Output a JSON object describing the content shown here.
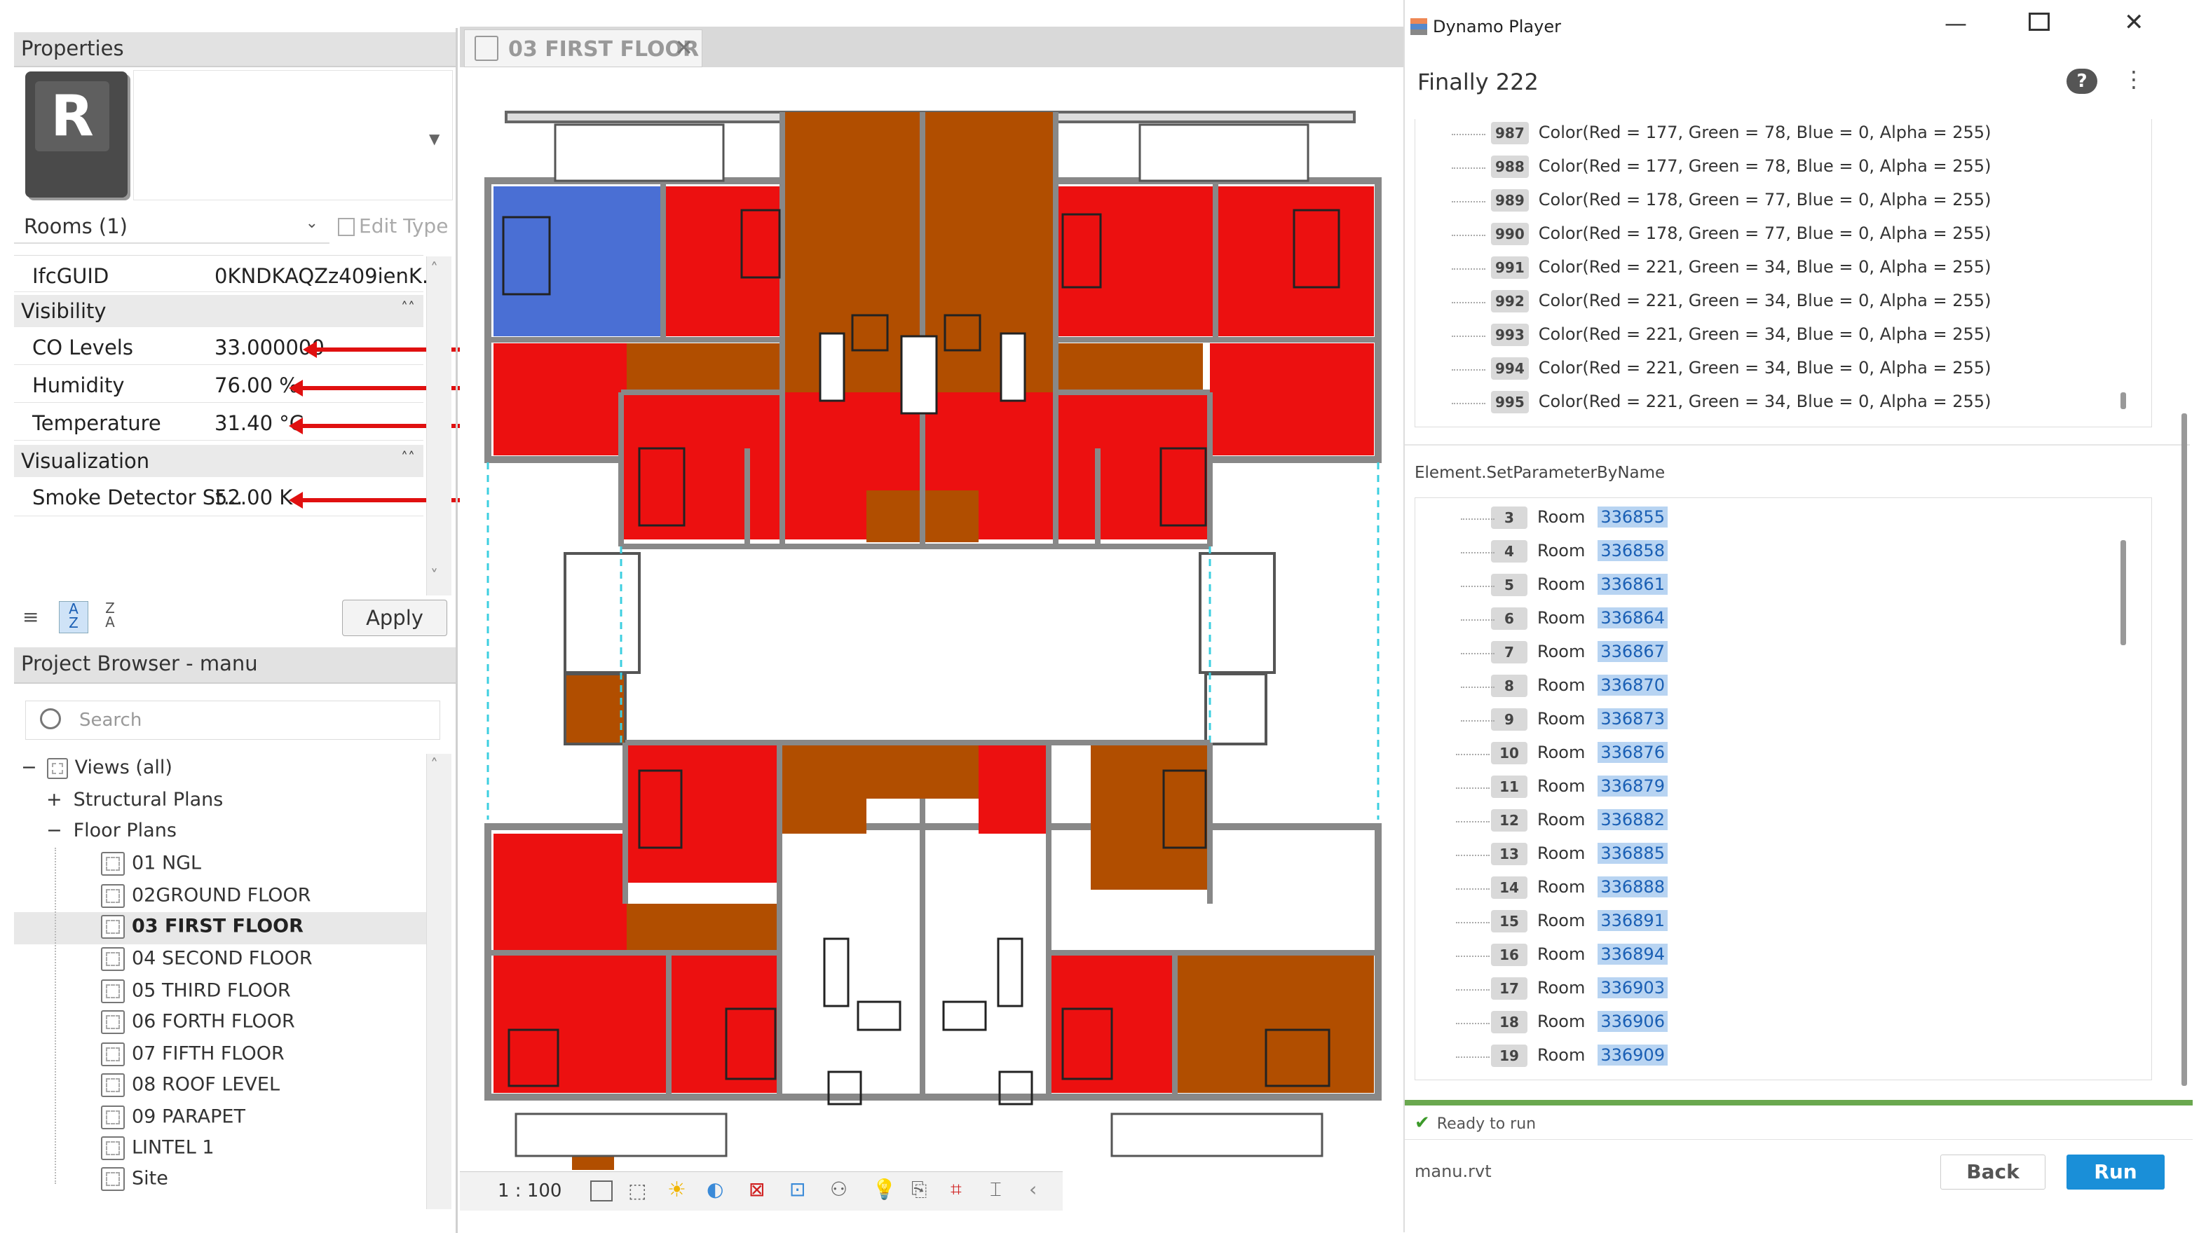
{
  "properties": {
    "header": "Properties",
    "type_selector": "Rooms (1)",
    "edit_type": "Edit Type",
    "rows": [
      {
        "label": "IfcGUID",
        "value": "0KNDKAQZz409ienK..."
      },
      {
        "label": "Visibility",
        "value": ""
      },
      {
        "label": "CO Levels",
        "value": "33.000000"
      },
      {
        "label": "Humidity",
        "value": "76.00 %"
      },
      {
        "label": "Temperature",
        "value": "31.40 °C"
      },
      {
        "label": "Visualization",
        "value": ""
      },
      {
        "label": "Smoke Detector St...",
        "value": "52.00 K"
      }
    ],
    "apply": "Apply",
    "app_icon_letter": "R"
  },
  "project_browser": {
    "header": "Project Browser - manu",
    "search_placeholder": "Search",
    "views_all": "Views (all)",
    "structural_plans": "Structural Plans",
    "floor_plans": "Floor Plans",
    "items": [
      "01 NGL",
      "02GROUND FLOOR",
      "03 FIRST FLOOR",
      "04 SECOND FLOOR",
      "05 THIRD FLOOR",
      "06 FORTH FLOOR",
      "07 FIFTH FLOOR",
      "08 ROOF LEVEL",
      "09 PARAPET",
      "LINTEL 1",
      "Site"
    ],
    "selected_index": 2
  },
  "view": {
    "tab_title": "03 FIRST FLOOR",
    "scale": "1 : 100"
  },
  "dynamo": {
    "window_title": "Dynamo Player",
    "script_name": "Finally 222",
    "colors": [
      {
        "i": "987",
        "text": "Color(Red = 177, Green = 78, Blue = 0, Alpha = 255)"
      },
      {
        "i": "988",
        "text": "Color(Red = 177, Green = 78, Blue = 0, Alpha = 255)"
      },
      {
        "i": "989",
        "text": "Color(Red = 178, Green = 77, Blue = 0, Alpha = 255)"
      },
      {
        "i": "990",
        "text": "Color(Red = 178, Green = 77, Blue = 0, Alpha = 255)"
      },
      {
        "i": "991",
        "text": "Color(Red = 221, Green = 34, Blue = 0, Alpha = 255)"
      },
      {
        "i": "992",
        "text": "Color(Red = 221, Green = 34, Blue = 0, Alpha = 255)"
      },
      {
        "i": "993",
        "text": "Color(Red = 221, Green = 34, Blue = 0, Alpha = 255)"
      },
      {
        "i": "994",
        "text": "Color(Red = 221, Green = 34, Blue = 0, Alpha = 255)"
      },
      {
        "i": "995",
        "text": "Color(Red = 221, Green = 34, Blue = 0, Alpha = 255)"
      }
    ],
    "node_name": "Element.SetParameterByName",
    "rooms": [
      {
        "i": "3",
        "label": "Room",
        "id": "336855"
      },
      {
        "i": "4",
        "label": "Room",
        "id": "336858"
      },
      {
        "i": "5",
        "label": "Room",
        "id": "336861"
      },
      {
        "i": "6",
        "label": "Room",
        "id": "336864"
      },
      {
        "i": "7",
        "label": "Room",
        "id": "336867"
      },
      {
        "i": "8",
        "label": "Room",
        "id": "336870"
      },
      {
        "i": "9",
        "label": "Room",
        "id": "336873"
      },
      {
        "i": "10",
        "label": "Room",
        "id": "336876"
      },
      {
        "i": "11",
        "label": "Room",
        "id": "336879"
      },
      {
        "i": "12",
        "label": "Room",
        "id": "336882"
      },
      {
        "i": "13",
        "label": "Room",
        "id": "336885"
      },
      {
        "i": "14",
        "label": "Room",
        "id": "336888"
      },
      {
        "i": "15",
        "label": "Room",
        "id": "336891"
      },
      {
        "i": "16",
        "label": "Room",
        "id": "336894"
      },
      {
        "i": "17",
        "label": "Room",
        "id": "336903"
      },
      {
        "i": "18",
        "label": "Room",
        "id": "336906"
      },
      {
        "i": "19",
        "label": "Room",
        "id": "336909"
      }
    ],
    "status": "Ready to run",
    "file": "manu.rvt",
    "back": "Back",
    "run": "Run"
  },
  "colors": {
    "hot_red": "#ec1010",
    "warm_brown": "#b14e00",
    "cool_blue": "#4a6fd4",
    "accent": "#1a8fd8",
    "status_green": "#5a9e2a"
  }
}
